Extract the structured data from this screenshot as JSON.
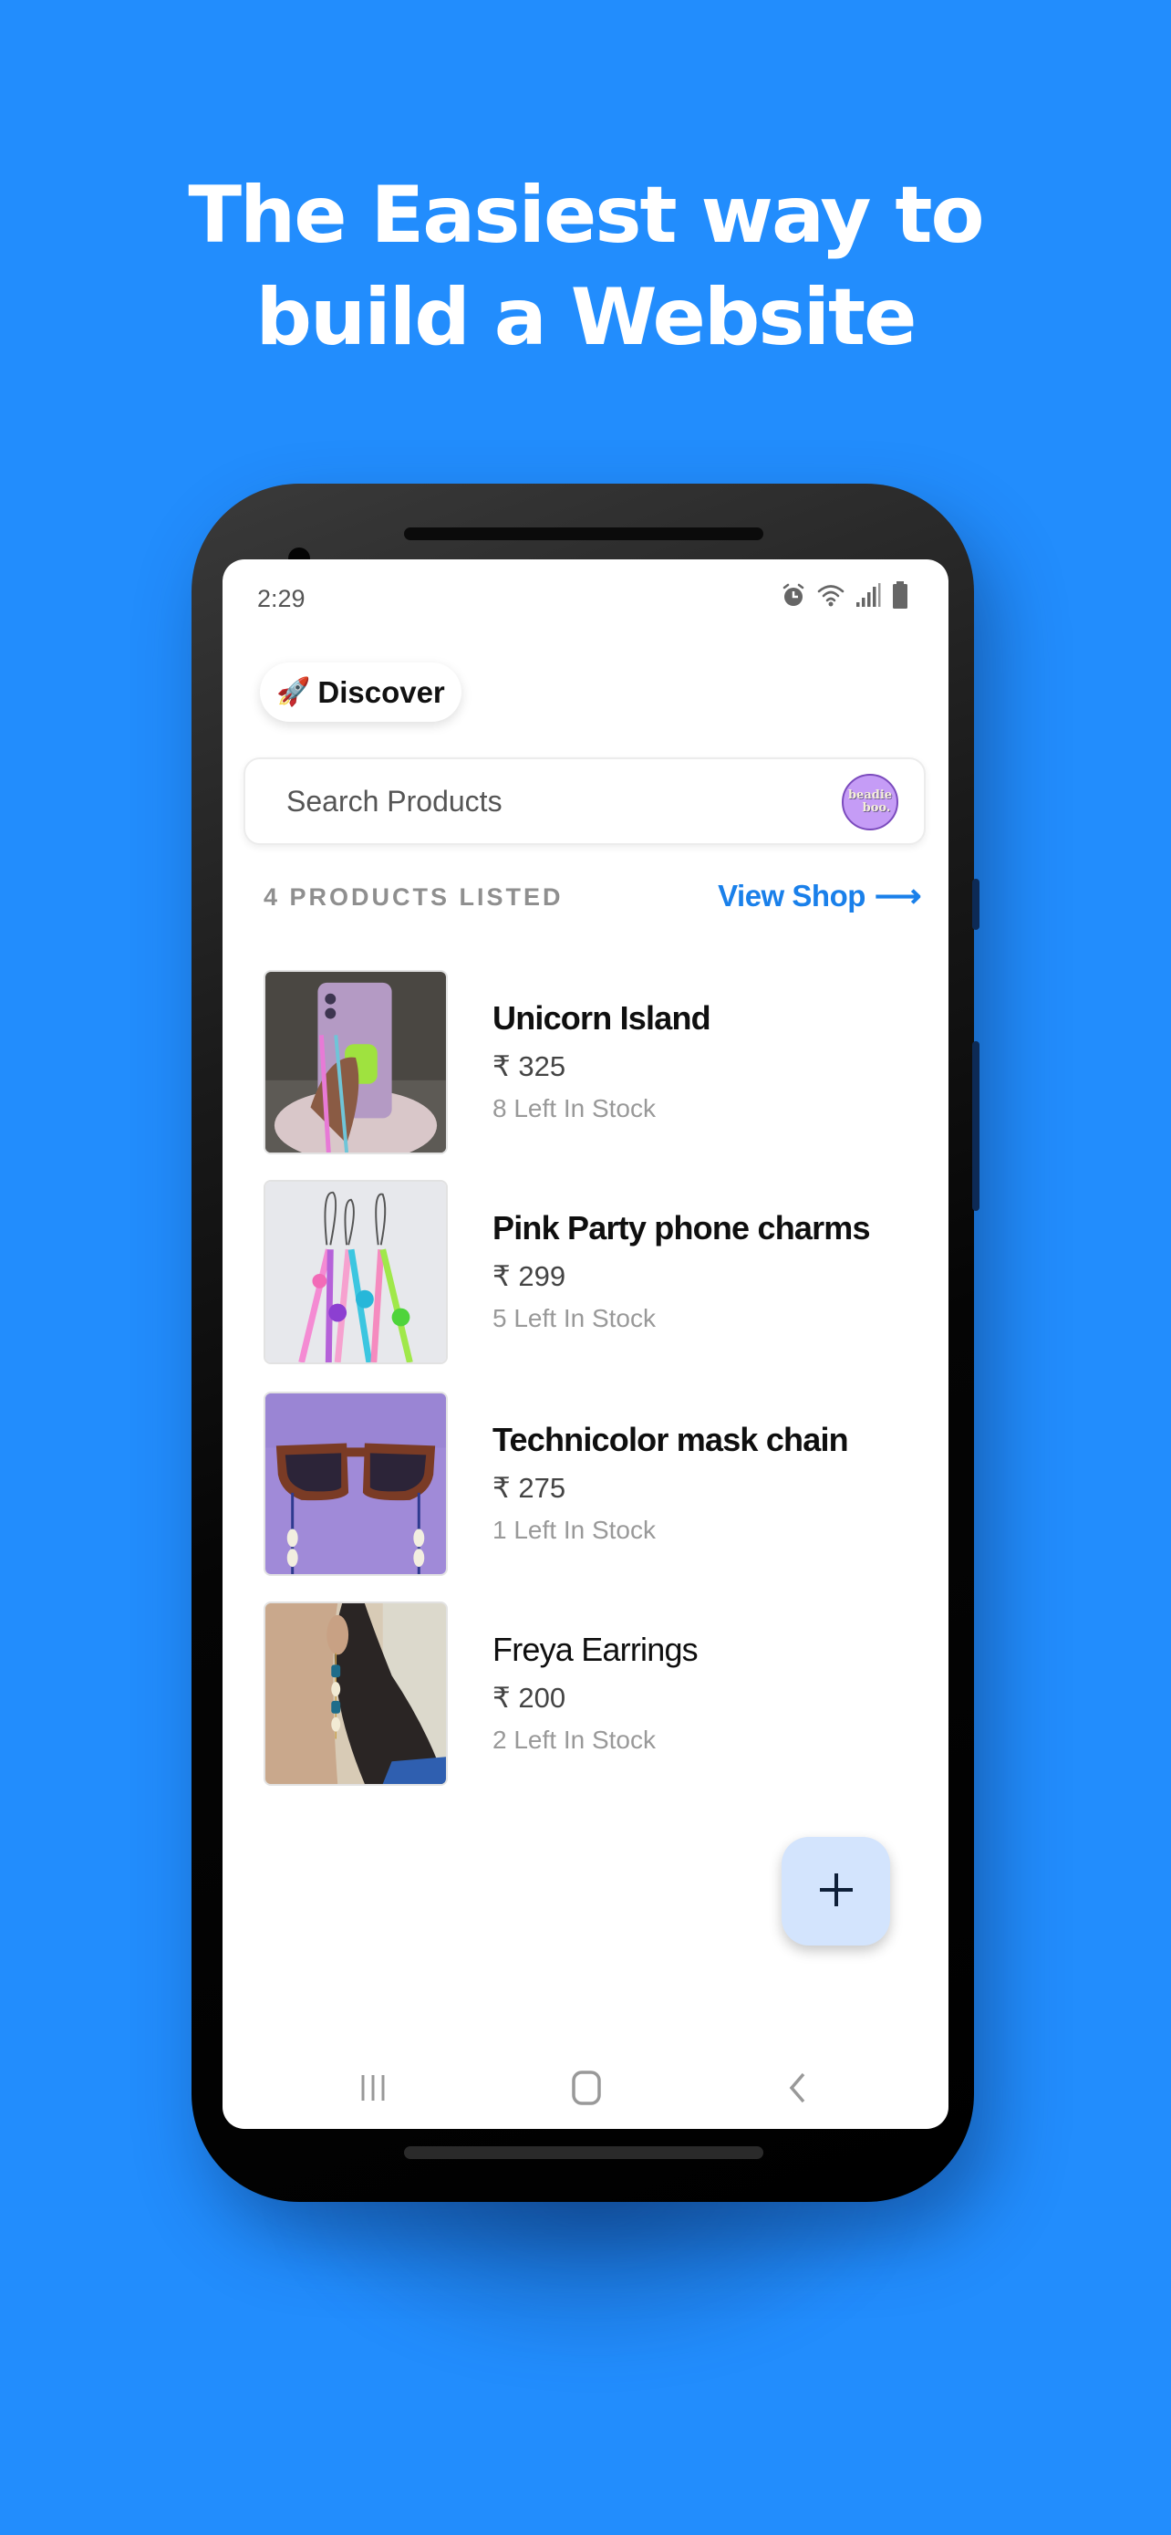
{
  "headline": {
    "line1": "The Easiest way to",
    "line2": "build a Website"
  },
  "colors": {
    "background": "#228dfd",
    "accent": "#1a80ea",
    "fab_background": "#d3e4fd",
    "avatar_background": "#c59cf6"
  },
  "status_bar": {
    "time": "2:29",
    "icons": [
      "alarm-icon",
      "wifi-icon",
      "signal-icon",
      "battery-icon"
    ]
  },
  "header": {
    "discover_emoji": "🚀",
    "discover_label": "Discover"
  },
  "search": {
    "placeholder": "Search Products",
    "value": "",
    "avatar_line1": "beadie",
    "avatar_line2": "boo."
  },
  "listing": {
    "count_label": "4 PRODUCTS LISTED",
    "view_shop_label": "View Shop",
    "view_shop_arrow": "⟶"
  },
  "products": [
    {
      "name": "Unicorn Island",
      "price": "₹ 325",
      "stock": "8 Left In Stock",
      "image": "phone-charm-photo"
    },
    {
      "name": "Pink Party phone charms",
      "price": "₹ 299",
      "stock": "5 Left In Stock",
      "image": "bead-charms-photo"
    },
    {
      "name": "Technicolor mask chain",
      "price": "₹ 275",
      "stock": "1 Left In Stock",
      "image": "sunglasses-chain-photo"
    },
    {
      "name": "Freya Earrings",
      "price": "₹ 200",
      "stock": "2 Left In Stock",
      "image": "earring-photo"
    }
  ],
  "fab": {
    "icon": "plus-icon"
  },
  "nav": {
    "items": [
      "recent-apps",
      "home",
      "back"
    ]
  }
}
